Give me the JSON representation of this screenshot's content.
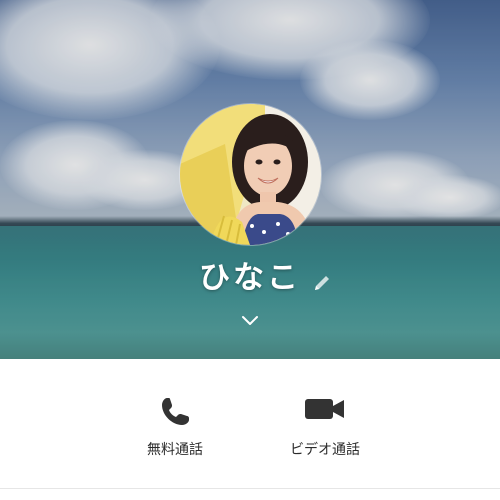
{
  "profile": {
    "name": "ひなこ"
  },
  "actions": [
    {
      "label": "無料通話",
      "icon": "phone-icon"
    },
    {
      "label": "ビデオ通話",
      "icon": "video-camera-icon"
    }
  ],
  "colors": {
    "overlay_text": "#ffffff",
    "action_icon": "#333333",
    "action_label": "#2b2b2b",
    "background": "#ffffff"
  }
}
